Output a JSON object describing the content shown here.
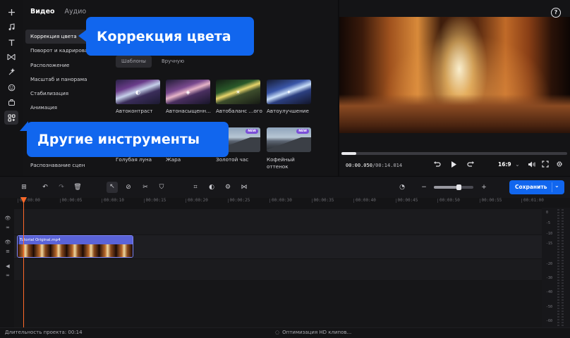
{
  "sidebar_icons": [
    "plus-icon",
    "music-icon",
    "text-icon",
    "transition-icon",
    "effects-icon",
    "sticker-icon",
    "media-icon",
    "more-tools-icon"
  ],
  "tabs": {
    "video": "Видео",
    "audio": "Аудио"
  },
  "menu": {
    "items": [
      "Коррекция цвета",
      "Поворот и кадрирование",
      "Расположение",
      "Масштаб и панорама",
      "Стабилизация",
      "Анимация"
    ],
    "last_item": "Распознавание сцен"
  },
  "segment": {
    "templates": "Шаблоны",
    "manual": "Вручную"
  },
  "presets": [
    {
      "label": "Автоконтраст",
      "icon": "contrast-icon",
      "badge": ""
    },
    {
      "label": "Автонасыщенн...",
      "icon": "saturation-icon",
      "badge": ""
    },
    {
      "label": "Автобаланс ...ого",
      "icon": "brightness-icon",
      "badge": ""
    },
    {
      "label": "Автоулучшение",
      "icon": "magic-wand-icon",
      "badge": ""
    },
    {
      "label": "Голубая луна",
      "badge": ""
    },
    {
      "label": "Жара",
      "badge": ""
    },
    {
      "label": "Золотой час",
      "badge": "NEW"
    },
    {
      "label": "Кофейный оттенок",
      "badge": "NEW"
    }
  ],
  "callouts": {
    "color_correction": "Коррекция цвета",
    "other_tools": "Другие инструменты"
  },
  "preview": {
    "current_time": "00:00.050",
    "total_time": "/00:14.014",
    "progress": 0.065,
    "aspect_ratio": "16:9",
    "help_label": "?"
  },
  "toolbar": {
    "save_label": "Сохранить",
    "zoom_level": 0.62
  },
  "ruler": [
    "00:00:00",
    "00:00:05",
    "00:00:10",
    "00:00:15",
    "00:00:20",
    "00:00:25",
    "00:00:30",
    "00:00:35",
    "00:00:40",
    "00:00:45",
    "00:00:50",
    "00:00:55",
    "00:01:00"
  ],
  "clip": {
    "name": "Tutorial Original.mp4"
  },
  "meter": [
    "0",
    "-5",
    "-10",
    "-15",
    "-20",
    "-30",
    "-40",
    "-50",
    "-60"
  ],
  "status": {
    "duration": "Длительность проекта: 00:14",
    "optimization": "Оптимизация HD клипов..."
  },
  "colors": {
    "accent": "#1166ee",
    "playhead": "#ff6a2a",
    "clip": "#5a63d8",
    "badge": "#7b4fd8"
  }
}
